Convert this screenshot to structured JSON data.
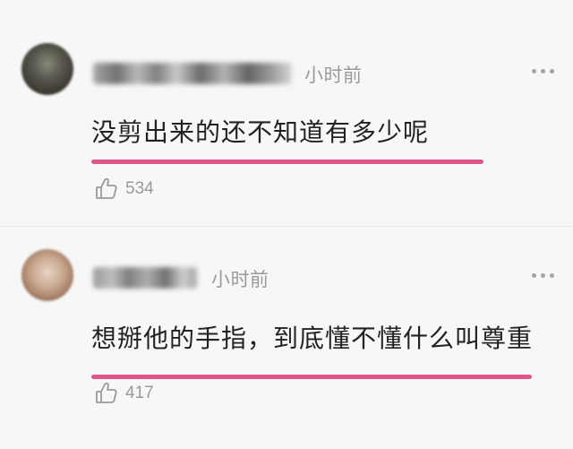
{
  "comments": [
    {
      "time": "小时前",
      "text": "没剪出来的还不知道有多少呢",
      "likes": "534",
      "username_blurred": true,
      "highlight_color": "#e0558b"
    },
    {
      "time": "小时前",
      "text": "想掰他的手指，到底懂不懂什么叫尊重",
      "likes": "417",
      "username_blurred": true,
      "highlight_color": "#e0558b"
    }
  ],
  "icons": {
    "like": "thumbs-up-icon",
    "more": "more-dots-icon"
  }
}
